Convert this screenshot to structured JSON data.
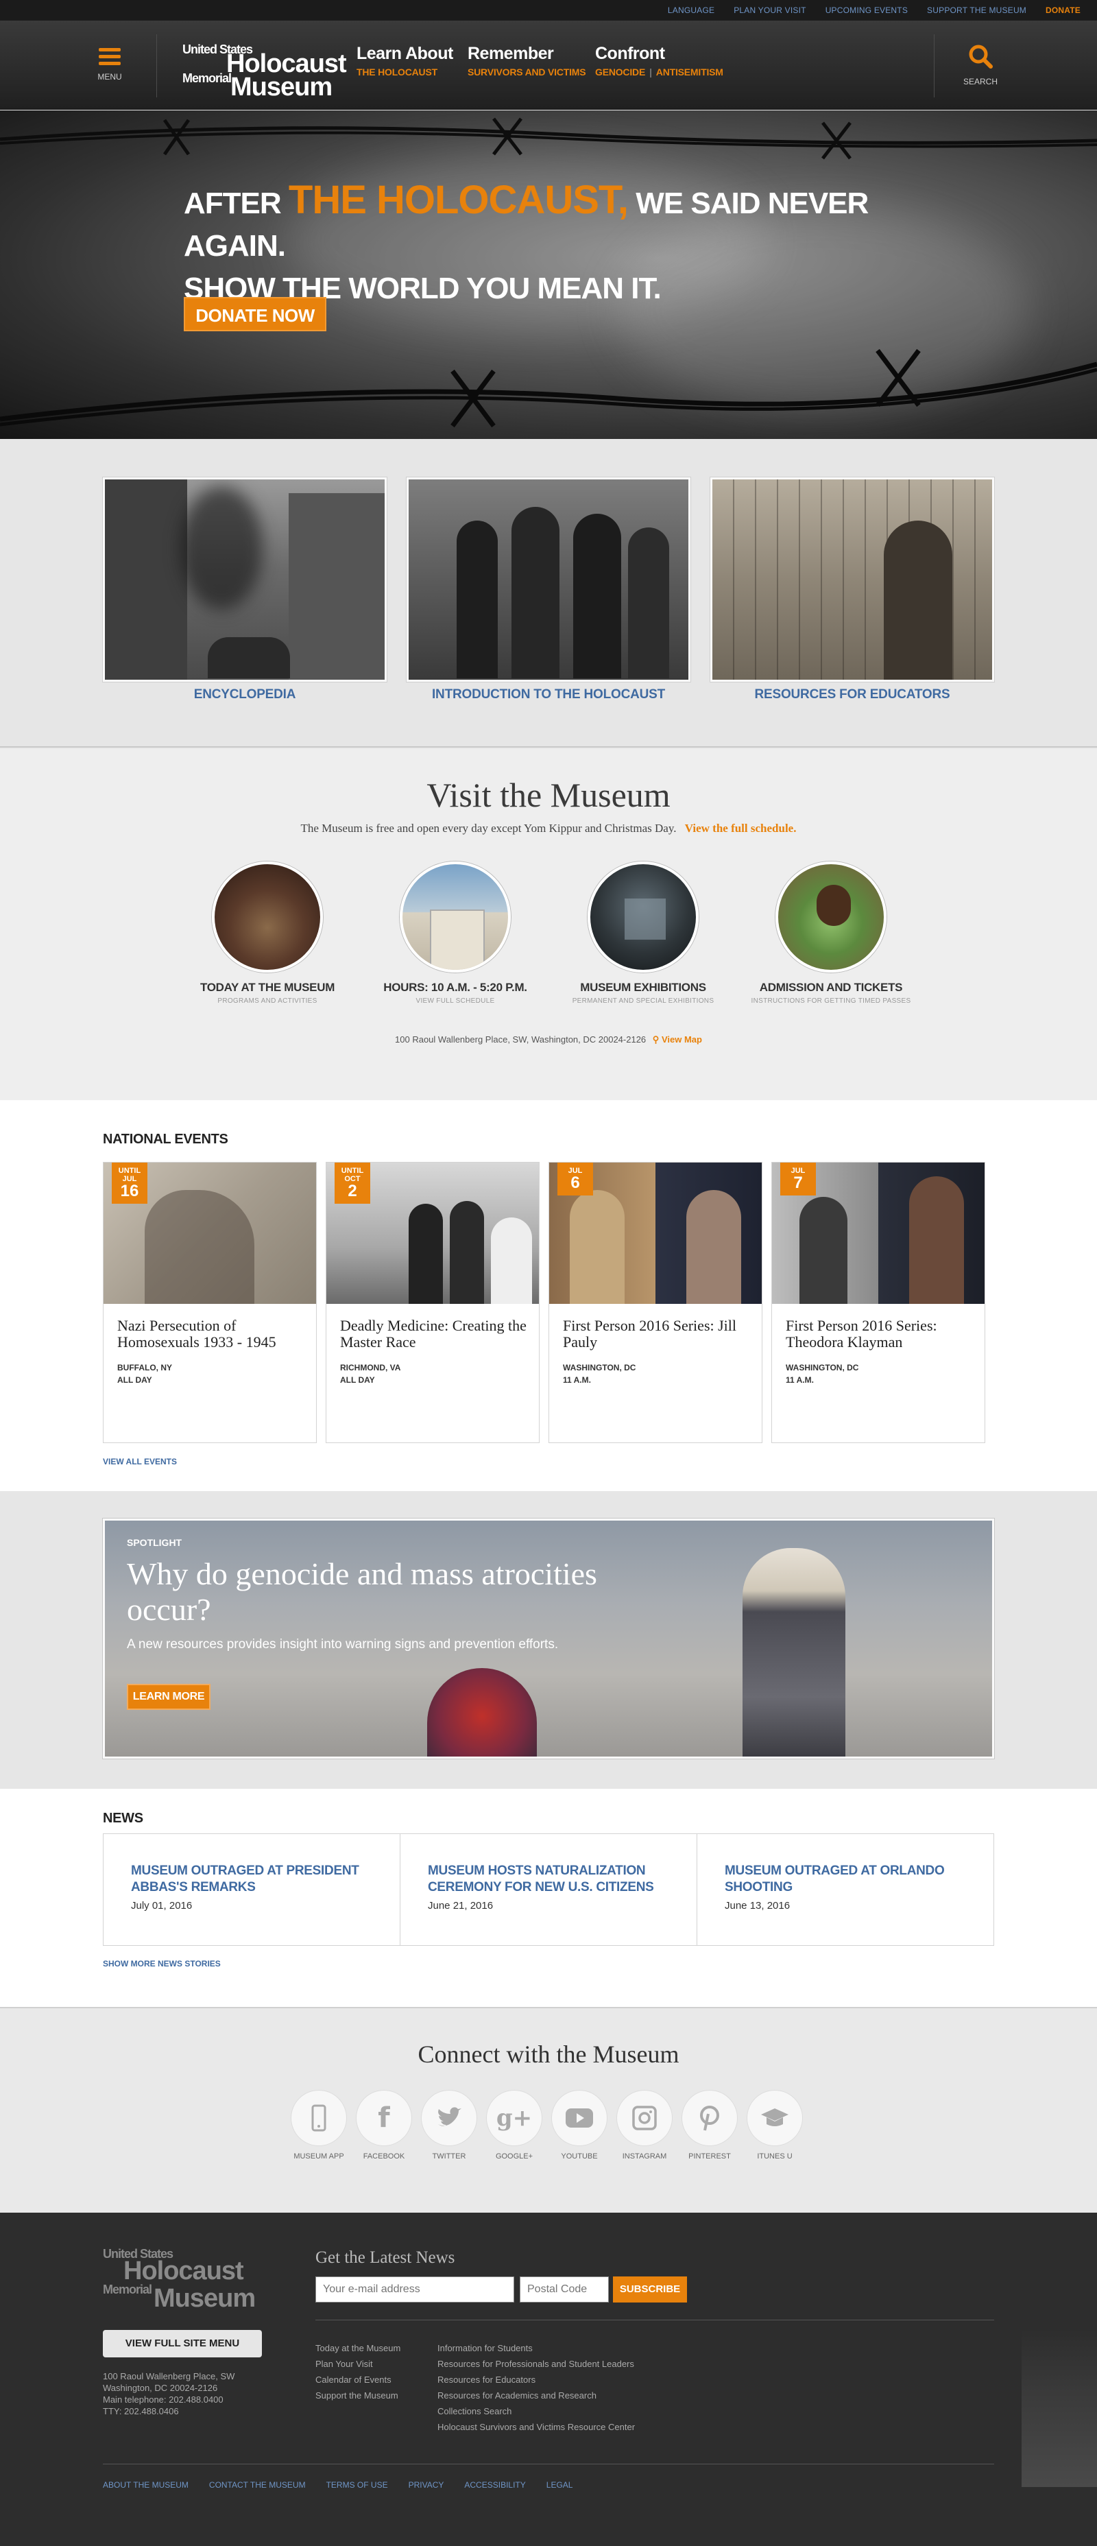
{
  "utility_nav": [
    "Language",
    "Plan Your Visit",
    "Upcoming Events",
    "Support the Museum",
    "Donate"
  ],
  "header": {
    "menu_label": "Menu",
    "logo": {
      "line1": "United States",
      "line2": "Holocaust",
      "line3": "Memorial",
      "line4": "Museum"
    },
    "nav": [
      {
        "title": "Learn About",
        "sub": [
          "The Holocaust"
        ]
      },
      {
        "title": "Remember",
        "sub": [
          "Survivors and Victims"
        ]
      },
      {
        "title": "Confront",
        "sub": [
          "Genocide",
          "Antisemitism"
        ]
      }
    ],
    "search_label": "Search"
  },
  "hero": {
    "line1_a": "After",
    "line1_accent": "the Holocaust,",
    "line1_b": "we said never again.",
    "line2": "Show the world you mean it.",
    "cta": "Donate Now"
  },
  "features": [
    "Encyclopedia",
    "Introduction to the Holocaust",
    "Resources for Educators"
  ],
  "visit": {
    "title": "Visit the Museum",
    "intro": "The Museum is free and open every day except Yom Kippur and Christmas Day.",
    "schedule_link": "View the full schedule.",
    "items": [
      {
        "title": "Today at the Museum",
        "sub": "Programs and Activities"
      },
      {
        "title": "Hours: 10 a.m. - 5:20 p.m.",
        "sub": "View full schedule"
      },
      {
        "title": "Museum Exhibitions",
        "sub": "Permanent and Special Exhibitions"
      },
      {
        "title": "Admission and Tickets",
        "sub": "Instructions for getting timed passes"
      }
    ],
    "address": "100 Raoul Wallenberg Place, SW, Washington, DC 20024-2126",
    "map_link": "View Map"
  },
  "events": {
    "heading": "National Events",
    "items": [
      {
        "badge_top": "Until Jul",
        "badge_day": "16",
        "title": "Nazi Persecution of Homosexuals 1933 - 1945",
        "location": "Buffalo, NY",
        "when": "All Day"
      },
      {
        "badge_top": "Until Oct",
        "badge_day": "2",
        "title": "Deadly Medicine: Creating the Master Race",
        "location": "Richmond, VA",
        "when": "All Day"
      },
      {
        "badge_top": "Jul",
        "badge_day": "6",
        "title": "First Person 2016 Series: Jill Pauly",
        "location": "Washington, DC",
        "when": "11 a.m."
      },
      {
        "badge_top": "Jul",
        "badge_day": "7",
        "title": "First Person 2016 Series: Theodora Klayman",
        "location": "Washington, DC",
        "when": "11 a.m."
      }
    ],
    "view_all": "View All Events"
  },
  "spotlight": {
    "tag": "Spotlight",
    "heading": "Why do genocide and mass atrocities occur?",
    "desc": "A new resources provides insight into warning signs and prevention efforts.",
    "cta": "Learn More"
  },
  "news": {
    "heading": "News",
    "items": [
      {
        "title": "Museum Outraged at President Abbas's Remarks",
        "date": "July 01, 2016"
      },
      {
        "title": "Museum Hosts Naturalization Ceremony for New U.S. Citizens",
        "date": "June 21, 2016"
      },
      {
        "title": "Museum Outraged at Orlando Shooting",
        "date": "June 13, 2016"
      }
    ],
    "more": "Show More News Stories"
  },
  "connect": {
    "title": "Connect with the Museum",
    "items": [
      {
        "label": "Museum App",
        "icon": "phone-icon"
      },
      {
        "label": "Facebook",
        "icon": "facebook-icon"
      },
      {
        "label": "Twitter",
        "icon": "twitter-icon"
      },
      {
        "label": "Google+",
        "icon": "googleplus-icon"
      },
      {
        "label": "YouTube",
        "icon": "youtube-icon"
      },
      {
        "label": "Instagram",
        "icon": "instagram-icon"
      },
      {
        "label": "Pinterest",
        "icon": "pinterest-icon"
      },
      {
        "label": "iTunes U",
        "icon": "graduation-cap-icon"
      }
    ]
  },
  "footer": {
    "logo": {
      "line1": "United States",
      "line2": "Holocaust",
      "line3": "Memorial",
      "line4": "Museum"
    },
    "menu_button": "View Full Site Menu",
    "address": [
      "100 Raoul Wallenberg Place, SW",
      "Washington, DC 20024-2126",
      "Main telephone: 202.488.0400",
      "TTY: 202.488.0406"
    ],
    "newsletter_title": "Get the Latest News",
    "email_placeholder": "Your e-mail address",
    "zip_placeholder": "Postal Code",
    "subscribe": "Subscribe",
    "links_col1": [
      "Today at the Museum",
      "Plan Your Visit",
      "Calendar of Events",
      "Support the Museum"
    ],
    "links_col2": [
      "Information for Students",
      "Resources for Professionals and Student Leaders",
      "Resources for Educators",
      "Resources for Academics and Research",
      "Collections Search",
      "Holocaust Survivors and Victims Resource Center"
    ],
    "bottom_links": [
      "About the Museum",
      "Contact the Museum",
      "Terms of Use",
      "Privacy",
      "Accessibility",
      "Legal"
    ]
  },
  "colors": {
    "accent": "#e8820c",
    "link": "#3f6aa1",
    "dark": "#2d2d2d"
  }
}
